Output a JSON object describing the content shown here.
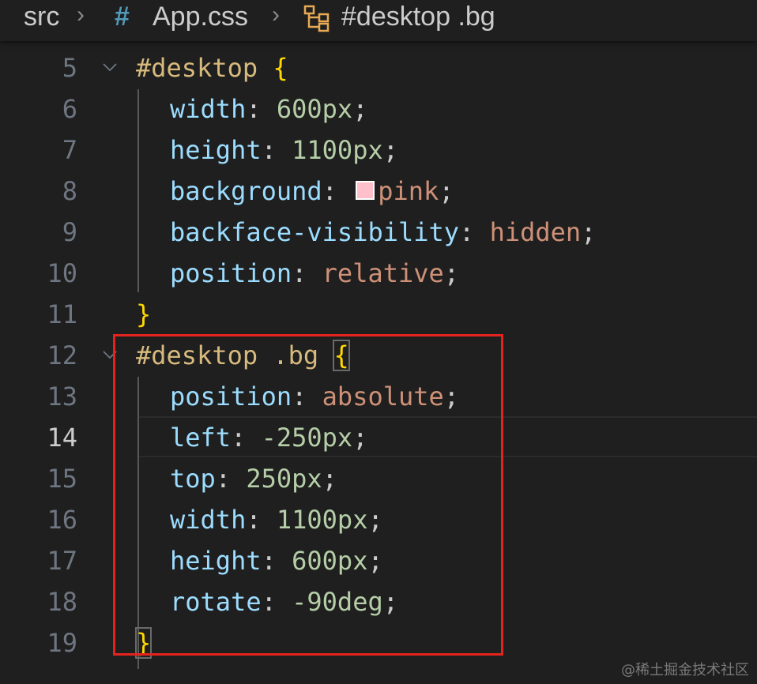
{
  "breadcrumb": {
    "segment_1": "src",
    "separator": "›",
    "file_icon": "css-hash-icon",
    "file_icon_glyph": "#",
    "segment_2": "App.css",
    "symbol_icon": "css-selector-symbol-icon",
    "segment_3": "#desktop .bg"
  },
  "editor": {
    "active_line": 14,
    "lines": [
      {
        "n": "5",
        "t": "#desktop {"
      },
      {
        "n": "6",
        "t": "  width: 600px;"
      },
      {
        "n": "7",
        "t": "  height: 1100px;"
      },
      {
        "n": "8",
        "t": "  background: pink;"
      },
      {
        "n": "9",
        "t": "  backface-visibility: hidden;"
      },
      {
        "n": "10",
        "t": "  position: relative;"
      },
      {
        "n": "11",
        "t": "}"
      },
      {
        "n": "12",
        "t": "#desktop .bg {"
      },
      {
        "n": "13",
        "t": "  position: absolute;"
      },
      {
        "n": "14",
        "t": "  left: -250px;"
      },
      {
        "n": "15",
        "t": "  top: 250px;"
      },
      {
        "n": "16",
        "t": "  width: 1100px;"
      },
      {
        "n": "17",
        "t": "  height: 600px;"
      },
      {
        "n": "18",
        "t": "  rotate: -90deg;"
      },
      {
        "n": "19",
        "t": "}"
      }
    ],
    "tokens": {
      "l5_sel": "#desktop",
      "l5_brace": "{",
      "l6_prop": "width",
      "l6_val": "600px",
      "l7_prop": "height",
      "l7_val": "1100px",
      "l8_prop": "background",
      "l8_val": "pink",
      "l9_prop": "backface-visibility",
      "l9_val": "hidden",
      "l10_prop": "position",
      "l10_val": "relative",
      "l11_brace": "}",
      "l12_sel": "#desktop .bg",
      "l12_brace": "{",
      "l13_prop": "position",
      "l13_val": "absolute",
      "l14_prop": "left",
      "l14_val": "-250px",
      "l15_prop": "top",
      "l15_val": "250px",
      "l16_prop": "width",
      "l16_val": "1100px",
      "l17_prop": "height",
      "l17_val": "600px",
      "l18_prop": "rotate",
      "l18_val": "-90deg",
      "l19_brace": "}",
      "colon": ":",
      "semicolon": ";"
    },
    "color_swatch": "#ffc0cb"
  },
  "watermark": "@稀土掘金技术社区",
  "colors": {
    "background": "#1f1f1f",
    "selector": "#d7ba7d",
    "property": "#9cdcfe",
    "number": "#b5cea8",
    "keyword_value": "#ce9178",
    "brace": "#ffd700",
    "highlight_box": "#e5231e"
  }
}
